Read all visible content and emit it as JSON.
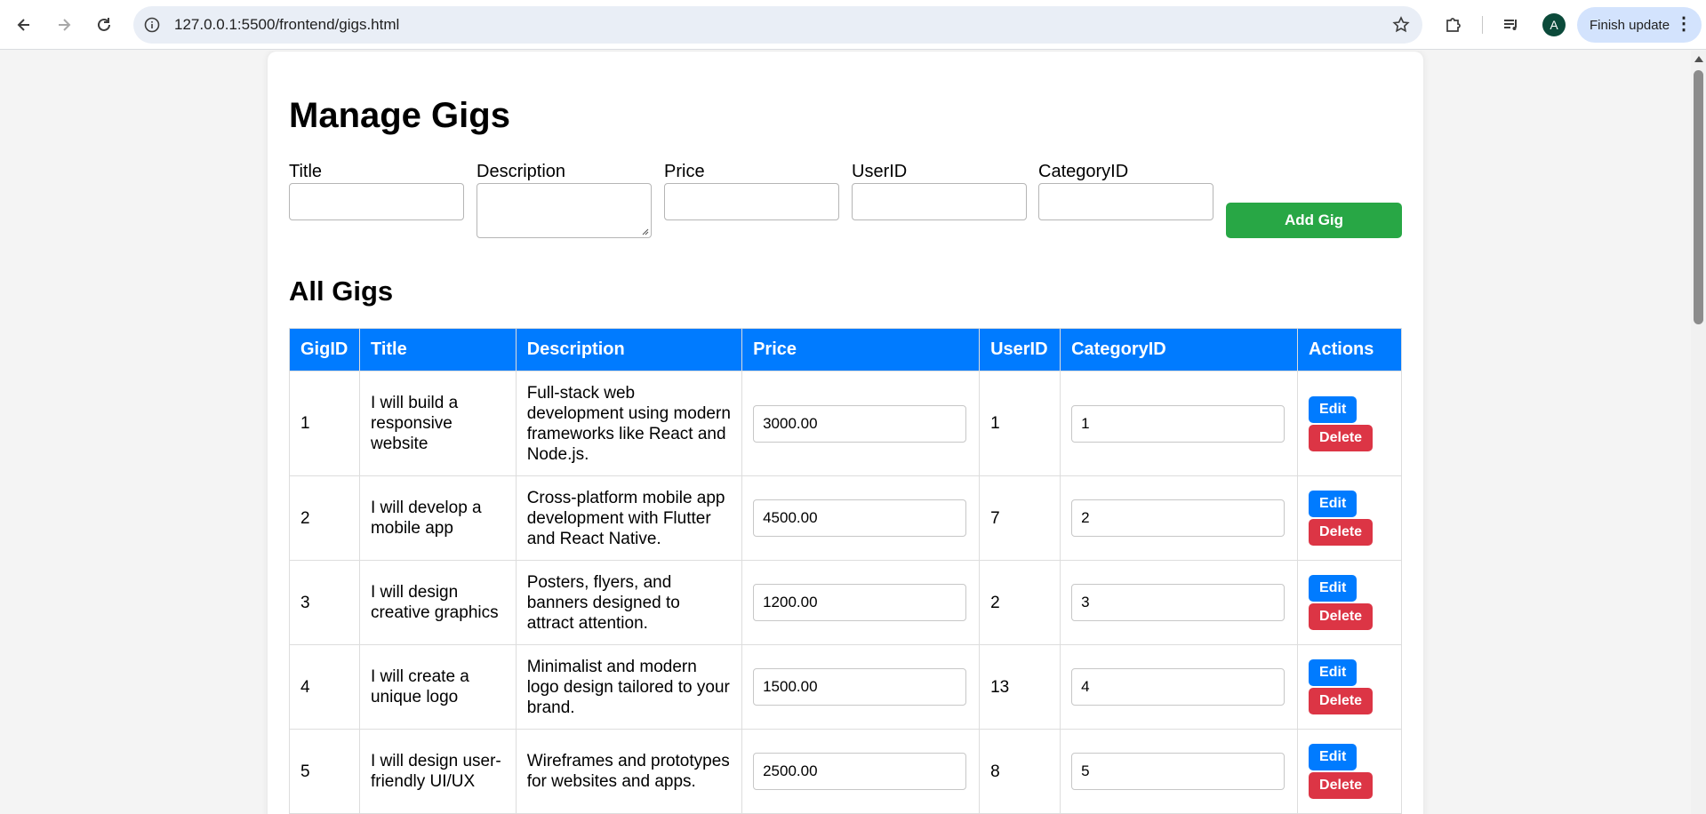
{
  "browser": {
    "url": "127.0.0.1:5500/frontend/gigs.html",
    "avatar_letter": "A",
    "finish_update": "Finish update"
  },
  "page": {
    "title": "Manage Gigs",
    "form": {
      "title_label": "Title",
      "description_label": "Description",
      "price_label": "Price",
      "userid_label": "UserID",
      "categoryid_label": "CategoryID",
      "title_value": "",
      "description_value": "",
      "price_value": "",
      "userid_value": "",
      "categoryid_value": "",
      "add_button": "Add Gig"
    },
    "list_title": "All Gigs",
    "table": {
      "headers": [
        "GigID",
        "Title",
        "Description",
        "Price",
        "UserID",
        "CategoryID",
        "Actions"
      ],
      "edit_label": "Edit",
      "delete_label": "Delete",
      "rows": [
        {
          "id": "1",
          "title": "I will build a responsive website",
          "description": "Full-stack web development using modern frameworks like React and Node.js.",
          "price": "3000.00",
          "user_id": "1",
          "category_id": "1"
        },
        {
          "id": "2",
          "title": "I will develop a mobile app",
          "description": "Cross-platform mobile app development with Flutter and React Native.",
          "price": "4500.00",
          "user_id": "7",
          "category_id": "2"
        },
        {
          "id": "3",
          "title": "I will design creative graphics",
          "description": "Posters, flyers, and banners designed to attract attention.",
          "price": "1200.00",
          "user_id": "2",
          "category_id": "3"
        },
        {
          "id": "4",
          "title": "I will create a unique logo",
          "description": "Minimalist and modern logo design tailored to your brand.",
          "price": "1500.00",
          "user_id": "13",
          "category_id": "4"
        },
        {
          "id": "5",
          "title": "I will design user-friendly UI/UX",
          "description": "Wireframes and prototypes for websites and apps.",
          "price": "2500.00",
          "user_id": "8",
          "category_id": "5"
        }
      ]
    }
  },
  "colors": {
    "primary": "#007bff",
    "success": "#28a745",
    "danger": "#dc3545"
  }
}
